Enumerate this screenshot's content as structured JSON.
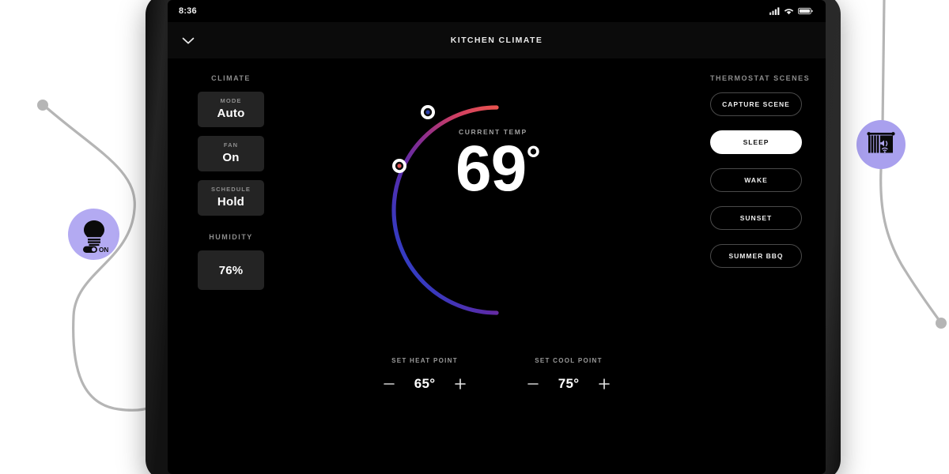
{
  "theme": {
    "page_bg": "#ffffff",
    "screen_bg": "#000000",
    "card_bg": "#242424",
    "accent_badge": "#b3aaf2",
    "heat_color": "#e0514f",
    "cool_color": "#2f49c9",
    "active_pill_bg": "#ffffff"
  },
  "decor": {
    "left_badge": {
      "icon": "lightbulb-icon",
      "toggle_label": "ON",
      "state": "on"
    },
    "right_badge": {
      "icon": "smart-blinds-icon"
    },
    "line_color": "#b5b5b5"
  },
  "status_bar": {
    "time": "8:36",
    "icons": [
      "cellular-signal-icon",
      "wifi-icon",
      "battery-icon"
    ]
  },
  "nav": {
    "back_icon": "chevron-down-icon",
    "title": "KITCHEN CLIMATE"
  },
  "left_panel": {
    "climate_heading": "CLIMATE",
    "cards": [
      {
        "label": "MODE",
        "value": "Auto"
      },
      {
        "label": "FAN",
        "value": "On"
      },
      {
        "label": "SCHEDULE",
        "value": "Hold"
      }
    ],
    "humidity_heading": "HUMIDITY",
    "humidity_value": "76%"
  },
  "dial": {
    "current_temp_label": "CURRENT TEMP",
    "current_temp_value": "69",
    "degree_symbol": "°",
    "heat_handle": {
      "name": "heat-handle",
      "color": "#e0514f",
      "angle_deg": 196
    },
    "cool_handle": {
      "name": "cool-handle",
      "color": "#2b3fa8",
      "angle_deg": 143
    }
  },
  "setpoints": [
    {
      "name": "heat",
      "label": "SET HEAT POINT",
      "value": "65°",
      "minus": "−",
      "plus": "+"
    },
    {
      "name": "cool",
      "label": "SET COOL POINT",
      "value": "75°",
      "minus": "−",
      "plus": "+"
    }
  ],
  "right_panel": {
    "heading": "THERMOSTAT SCENES",
    "scenes": [
      {
        "label": "CAPTURE SCENE",
        "active": false
      },
      {
        "label": "SLEEP",
        "active": true
      },
      {
        "label": "WAKE",
        "active": false
      },
      {
        "label": "SUNSET",
        "active": false
      },
      {
        "label": "SUMMER BBQ",
        "active": false
      }
    ]
  }
}
